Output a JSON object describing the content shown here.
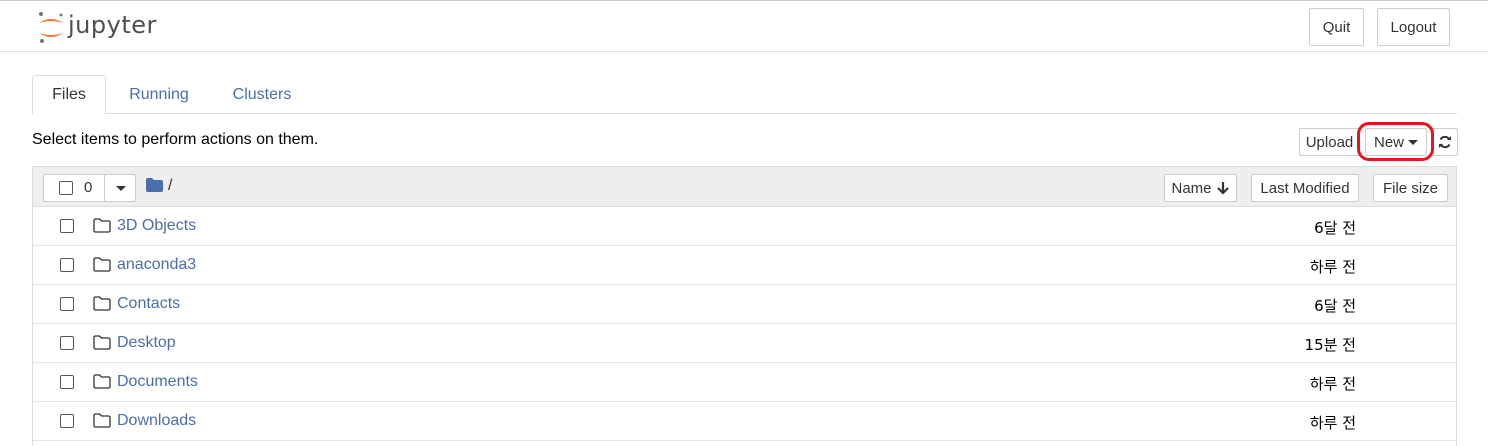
{
  "header": {
    "logo_text": "jupyter",
    "quit_label": "Quit",
    "logout_label": "Logout"
  },
  "tabs": [
    {
      "label": "Files"
    },
    {
      "label": "Running"
    },
    {
      "label": "Clusters"
    }
  ],
  "toolbar": {
    "info_text": "Select items to perform actions on them.",
    "upload_label": "Upload",
    "new_label": "New",
    "refresh_icon": "refresh-icon"
  },
  "list_header": {
    "selected_count": "0",
    "path": "/",
    "sort_name_label": "Name",
    "sort_modified_label": "Last Modified",
    "sort_size_label": "File size"
  },
  "items": [
    {
      "name": "3D Objects",
      "modified": "6달 전",
      "type": "folder"
    },
    {
      "name": "anaconda3",
      "modified": "하루 전",
      "type": "folder"
    },
    {
      "name": "Contacts",
      "modified": "6달 전",
      "type": "folder"
    },
    {
      "name": "Desktop",
      "modified": "15분 전",
      "type": "folder"
    },
    {
      "name": "Documents",
      "modified": "하루 전",
      "type": "folder"
    },
    {
      "name": "Downloads",
      "modified": "하루 전",
      "type": "folder"
    }
  ],
  "colors": {
    "link": "#4a6ea9",
    "highlight": "#e8131b",
    "logo_orange": "#f37726"
  }
}
